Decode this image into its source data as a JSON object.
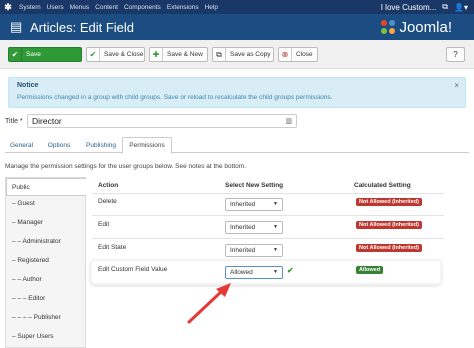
{
  "topbar": {
    "menu": [
      "System",
      "Users",
      "Menus",
      "Content",
      "Components",
      "Extensions",
      "Help"
    ],
    "user_label": "I love Custom..."
  },
  "header": {
    "title": "Articles: Edit Field",
    "brand": "Joomla!"
  },
  "toolbar": {
    "save": "Save",
    "save_close": "Save & Close",
    "save_new": "Save & New",
    "save_copy": "Save as Copy",
    "close": "Close"
  },
  "notice": {
    "heading": "Notice",
    "message": "Permissions changed in a group with child groups. Save or reload to recalculate the child groups permissions."
  },
  "form": {
    "title_label": "Title *",
    "title_value": "Director"
  },
  "tabs": [
    "General",
    "Options",
    "Publishing",
    "Permissions"
  ],
  "permissions": {
    "intro": "Manage the permission settings for the user groups below. See notes at the bottom.",
    "groups": [
      "Public",
      "– Guest",
      "– Manager",
      "– – Administrator",
      "– Registered",
      "– – Author",
      "– – – Editor",
      "– – – – Publisher",
      "– Super Users"
    ],
    "columns": [
      "Action",
      "Select New Setting",
      "Calculated Setting"
    ],
    "rows": [
      {
        "action": "Delete",
        "setting": "Inherited",
        "calculated": "Not Allowed (Inherited)"
      },
      {
        "action": "Edit",
        "setting": "Inherited",
        "calculated": "Not Allowed (Inherited)"
      },
      {
        "action": "Edit State",
        "setting": "Inherited",
        "calculated": "Not Allowed (Inherited)"
      },
      {
        "action": "Edit Custom Field Value",
        "setting": "Allowed",
        "calculated": "Allowed"
      }
    ]
  },
  "colors": {
    "header": "#1b4d82",
    "topbar": "#1a3867",
    "save_button": "#2f9937",
    "not_allowed": "#bd362f",
    "allowed": "#378137",
    "arrow": "#e53935"
  }
}
